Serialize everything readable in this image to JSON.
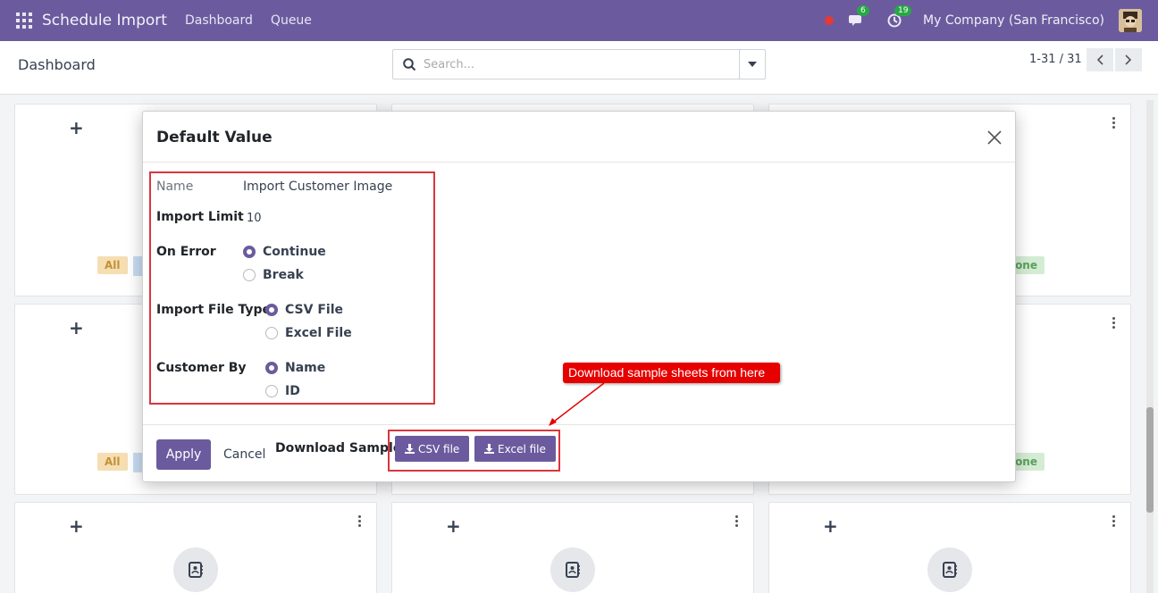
{
  "navbar": {
    "app_title": "Schedule Import",
    "links": [
      "Dashboard",
      "Queue"
    ],
    "messages_count": "6",
    "activities_count": "19",
    "company": "My Company (San Francisco)"
  },
  "control_panel": {
    "breadcrumb": "Dashboard",
    "search_placeholder": "Search...",
    "pager": "1-31 / 31"
  },
  "kanban": {
    "tag_all": "All",
    "tag_done": "one"
  },
  "modal": {
    "title": "Default Value",
    "fields": {
      "name_label": "Name",
      "name_value": "Import Customer Image",
      "import_limit_label": "Import Limit",
      "import_limit_value": "10",
      "on_error_label": "On Error",
      "on_error_options": [
        "Continue",
        "Break"
      ],
      "on_error_selected": "Continue",
      "file_type_label": "Import File Type",
      "file_type_options": [
        "CSV File",
        "Excel File"
      ],
      "file_type_selected": "CSV File",
      "customer_by_label": "Customer By",
      "customer_by_options": [
        "Name",
        "ID"
      ],
      "customer_by_selected": "Name"
    },
    "footer": {
      "apply_label": "Apply",
      "cancel_label": "Cancel",
      "download_label": "Download Sample:",
      "csv_button": "CSV file",
      "excel_button": "Excel file"
    }
  },
  "annotation": {
    "callout_text": "Download sample sheets from here"
  },
  "colors": {
    "brand": "#6b5b9e",
    "annotation_red": "#e60000",
    "highlight_border": "#d9363e"
  }
}
